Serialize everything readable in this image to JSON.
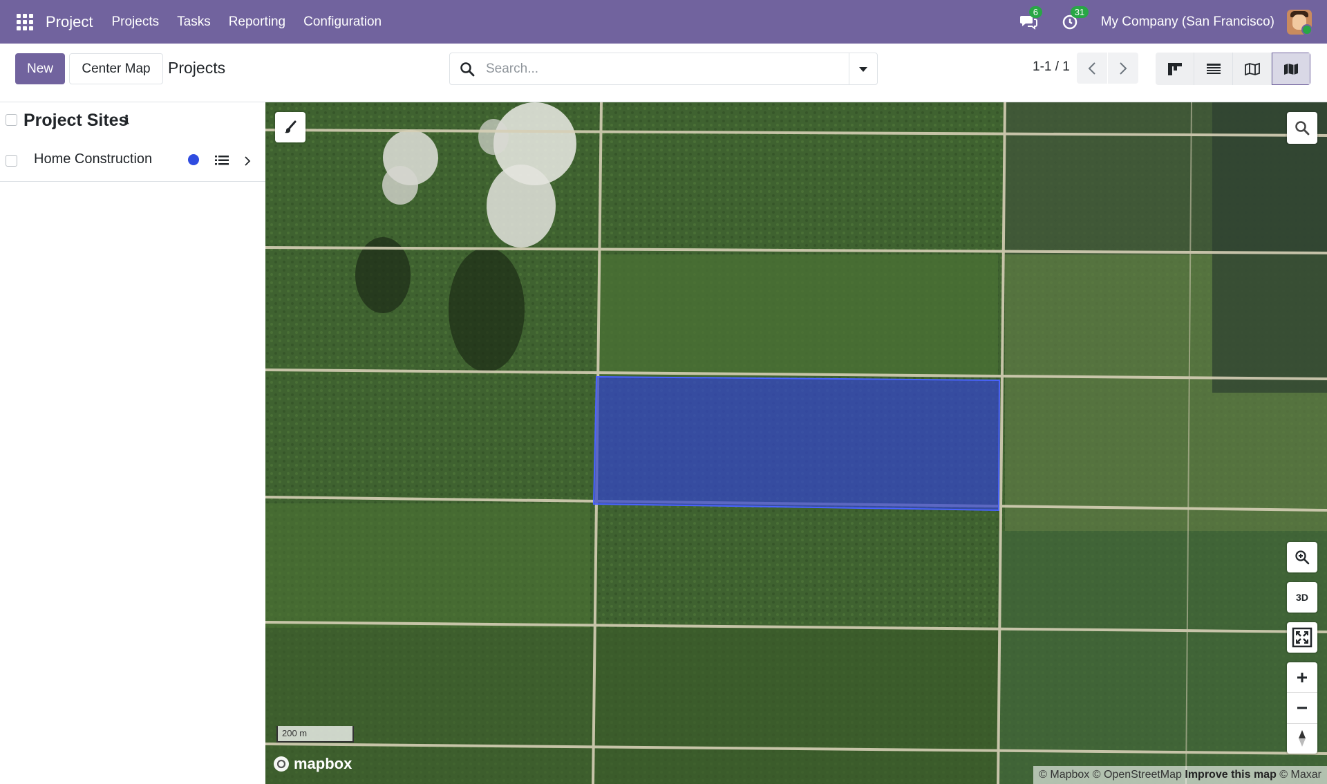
{
  "topbar": {
    "app_name": "Project",
    "menu": [
      "Projects",
      "Tasks",
      "Reporting",
      "Configuration"
    ],
    "messages_badge": "6",
    "activities_badge": "31",
    "company": "My Company (San Francisco)",
    "accent_color": "#71639e"
  },
  "control": {
    "new_label": "New",
    "center_map_label": "Center Map",
    "breadcrumb": "Projects",
    "search_placeholder": "Search...",
    "pager": "1-1 / 1",
    "views": [
      "kanban-view-icon",
      "list-view-icon",
      "map-view-icon",
      "map-layer-view-icon"
    ],
    "active_view": "map-layer-view-icon"
  },
  "sidebar": {
    "title": "Project Sites",
    "info_icon": "info-icon",
    "items": [
      {
        "label": "Home Construction",
        "color": "#2f4ce0"
      }
    ]
  },
  "map": {
    "scale_label": "200 m",
    "logo_text": "mapbox",
    "controls": [
      "brush-icon",
      "search-icon",
      "zoom-to-fit-icon",
      "3D",
      "fullscreen-icon",
      "plus-icon",
      "minus-icon",
      "compass-icon"
    ],
    "attribution": {
      "part1": "© Mapbox © OpenStreetMap ",
      "improve": "Improve this map",
      "part2": " © Maxar"
    },
    "polygon_color": "#3344cc"
  }
}
